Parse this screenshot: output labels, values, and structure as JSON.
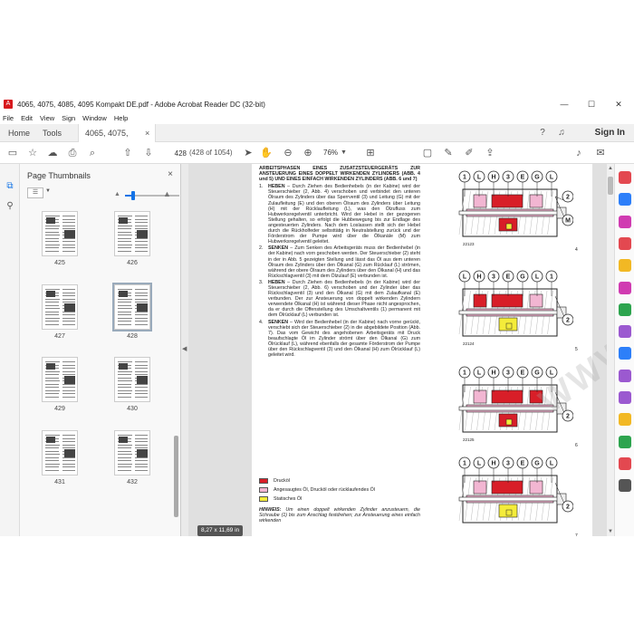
{
  "window": {
    "title": "4065, 4075, 4085, 4095 Kompakt DE.pdf - Adobe Acrobat Reader DC (32-bit)",
    "app_icon_glyph": "A",
    "controls": {
      "minimize": "—",
      "maximize": "☐",
      "close": "✕"
    }
  },
  "menubar": {
    "items": [
      "File",
      "Edit",
      "View",
      "Sign",
      "Window",
      "Help"
    ]
  },
  "tabs": {
    "home": "Home",
    "tools": "Tools",
    "document": "4065, 4075, 4085, ...",
    "close": "×",
    "help_icon": "help-icon",
    "bell_icon": "bell-icon",
    "sign_in": "Sign In"
  },
  "toolbar": {
    "page_current": "428",
    "page_count": "(428 of 1054)",
    "zoom": "76%",
    "icons": [
      "save-icon",
      "bookmark-star-icon",
      "upload-icon",
      "print-icon",
      "search-icon",
      "page-up-icon",
      "page-down-icon",
      "select-cursor-icon",
      "hand-icon",
      "zoom-out-icon",
      "zoom-in-icon",
      "fit-page-icon",
      "comment-icon",
      "highlight-pen-icon",
      "sign-icon",
      "share-icon",
      "read-aloud-icon",
      "send-icon"
    ]
  },
  "thumbnails_panel": {
    "title": "Page Thumbnails",
    "close": "×",
    "pages": [
      "425",
      "426",
      "427",
      "428",
      "429",
      "430",
      "431",
      "432"
    ],
    "selected_page": "428",
    "size_level": 0.15
  },
  "document": {
    "page_size_label": "8,27 x 11,69 in",
    "heading": "ARBEITSPHASEN EINES ZUSATZSTEUERGERÄTS ZUR ANSTEUERUNG EINES DOPPELT WIRKENDEN ZYLINDERS (ABB. 4 und 5) UND EINES EINFACH WIRKENDEN ZYLINDERS (ABB. 6 und 7)",
    "steps": [
      {
        "num": "1.",
        "label": "HEBEN",
        "text": " – Durch Ziehen des Bedienhebels (in der Kabine) wird der Steuerschieber (2, Abb. 4) verschoben und verbindet den unteren Ölraum des Zylinders über das Sperrventil (3) und Leitung (G) mit der Zulaufleitung (E) und den oberen Ölraum des Zylinders über Leitung (H) mit der Rücklaufleitung (L), was den Ölzufluss zum Hubwerksregelventil unterbricht. Wird der Hebel in der gezogenen Stellung gehalten, so erfolgt die Hubbewegung bis zur Endlage des angesteuerten Zylinders. Nach dem Loslassen stellt sich der Hebel durch die Rückholfeder selbsttätig in Neutralstellung zurück und der Förderstrom der Pumpe wird über die Ölkanäle (M) zum Hubwerksregelventil geleitet."
      },
      {
        "num": "2.",
        "label": "SENKEN",
        "text": " – Zum Senken des Arbeitsgeräts muss der Bedienhebel (in der Kabine) nach vorn geschoben werden. Der Steuerschieber (2) steht in der in Abb. 5 gezeigten Stellung und lässt das Öl aus dem unteren Ölraum des Zylinders über den Ölkanal (G) zum Rücklauf (L) strömen, während der obere Ölraum des Zylinders über den Ölkanal (H) und das Rückschlagventil (3) mit dem Ölzulauf (E) verbunden ist."
      },
      {
        "num": "3.",
        "label": "HEBEN",
        "text": " – Durch Ziehen des Bedienhebels (in der Kabine) wird der Steuerschieber (2, Abb. 6) verschoben und der Zylinder über das Rückschlagventil (3) und den Ölkanal (G) mit dem Zulaufkanal (E) verbunden. Der zur Ansteuerung von doppelt wirkenden Zylindern verwendete Ölkanal (H) ist während dieser Phase nicht angesprochen, da er durch die Offenstellung des Umschaltventils (1) permanent mit dem Ölrücklauf (L) verbunden ist."
      },
      {
        "num": "4.",
        "label": "SENKEN",
        "text": " – Wird der Bedienhebel (in der Kabine) nach vorne gerückt, verschiebt sich der Steuerschieber (2) in die abgebildete Position (Abb. 7). Das vom Gewicht des angehobenen Arbeitsgeräts mit Druck beaufschlagte Öl im Zylinder strömt über den Ölkanal (G) zum Ölrücklauf (L), während ebenfalls der gesamte Förderstrom der Pumpe über den Rückschlagventil (3) und den Ölkanal (H) zum Ölrücklauf (L) geleitet wird."
      }
    ],
    "legend": [
      {
        "label": "Drucköl",
        "color": "#d81e28"
      },
      {
        "label": "Angesaugtes Öl, Drucköl oder rücklaufendes Öl",
        "color": "#f2b6d2"
      },
      {
        "label": "Statisches Öl",
        "color": "#f4ec3a"
      }
    ],
    "note_label": "HINWEIS:",
    "note_text": " Um einen doppelt wirkenden Zylinder anzusteuern, die Schraube (1) bis zum Anschlag festdrehen; zur Ansteuerung eines einfach wirkenden",
    "figures": [
      {
        "num": "4",
        "code": "22123",
        "labels": [
          "1",
          "L",
          "H",
          "3",
          "E",
          "G",
          "L",
          "2",
          "M"
        ]
      },
      {
        "num": "5",
        "code": "22124",
        "labels": [
          "L",
          "H",
          "3",
          "E",
          "G",
          "L",
          "1",
          "2"
        ]
      },
      {
        "num": "6",
        "code": "22125",
        "labels": [
          "1",
          "L",
          "H",
          "3",
          "E",
          "G",
          "L",
          "2"
        ]
      },
      {
        "num": "7",
        "code": "",
        "labels": [
          "1",
          "L",
          "H",
          "3",
          "E",
          "G",
          "L",
          "2"
        ]
      }
    ],
    "watermark": "WWW.EPCATALOGS.COM"
  },
  "colors": {
    "accent": "#1473e6",
    "pressure_oil": "#d81e28",
    "return_oil": "#f2b6d2",
    "static_oil": "#f4ec3a"
  },
  "right_tools": [
    "export-pdf-icon",
    "create-pdf-icon",
    "edit-pdf-icon",
    "combine-files-icon",
    "comment-tool-icon",
    "organize-pages-icon",
    "scan-icon",
    "fill-sign-icon",
    "protect-icon",
    "prepare-form-icon",
    "send-for-signature-icon",
    "more-tools-icon",
    "stamp-icon",
    "redact-icon",
    "optimize-icon"
  ]
}
